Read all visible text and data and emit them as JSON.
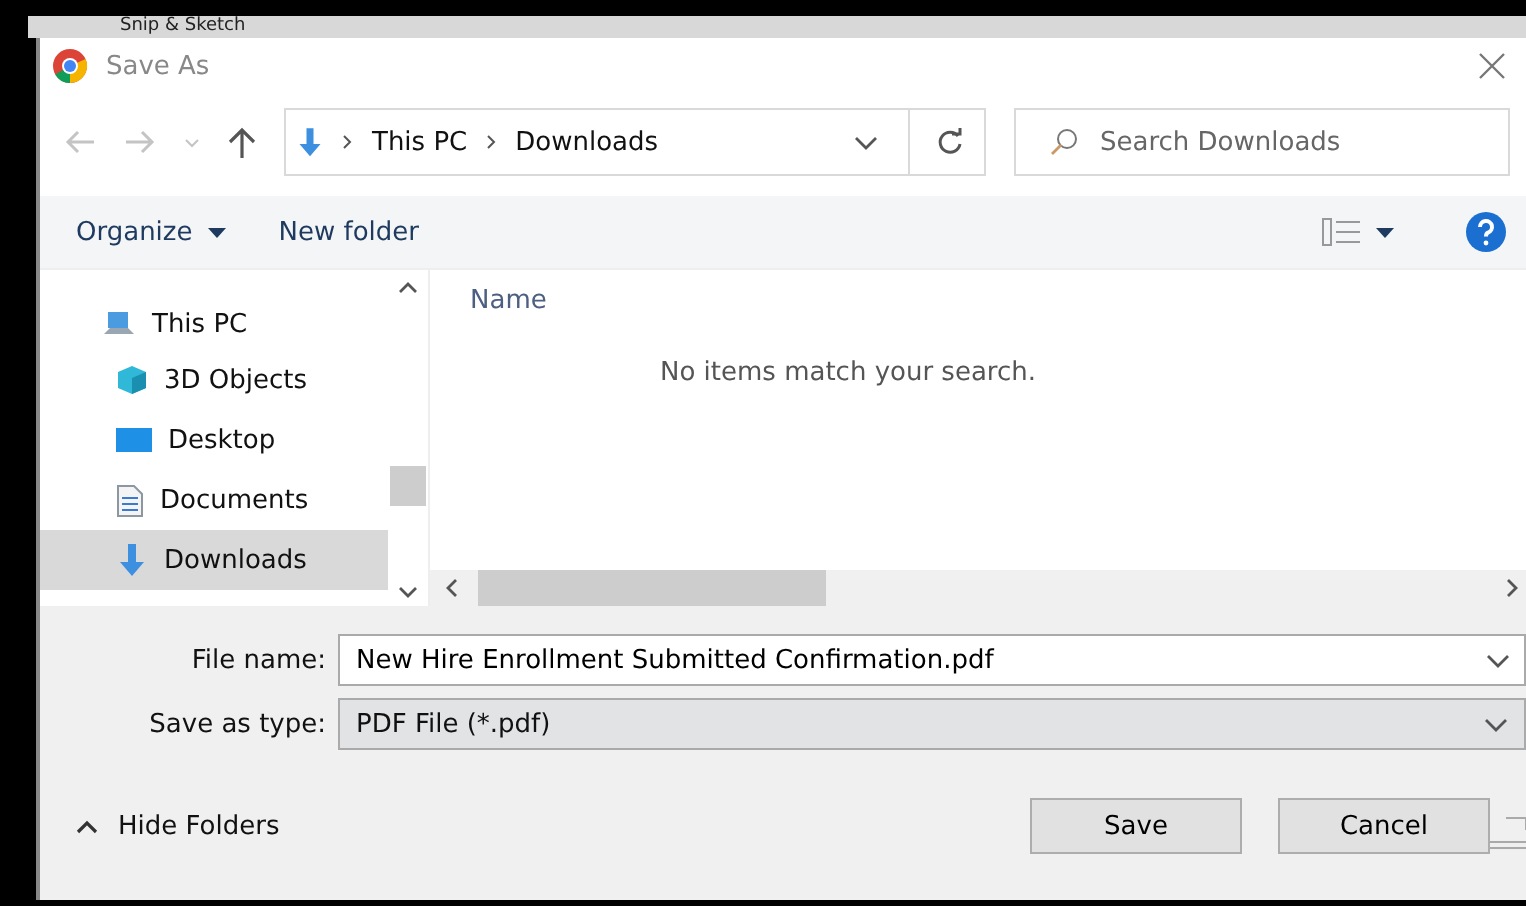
{
  "background_app": {
    "title": "Snip & Sketch"
  },
  "window": {
    "title": "Save As"
  },
  "nav": {
    "path": [
      "This PC",
      "Downloads"
    ],
    "search": {
      "placeholder": "Search Downloads"
    }
  },
  "toolbar": {
    "organize": "Organize",
    "new_folder": "New folder"
  },
  "sidebar": {
    "items": [
      {
        "label": "This PC",
        "kind": "pc",
        "selected": false,
        "children": [
          {
            "label": "3D Objects",
            "kind": "cube",
            "selected": false
          },
          {
            "label": "Desktop",
            "kind": "desktop",
            "selected": false
          },
          {
            "label": "Documents",
            "kind": "documents",
            "selected": false
          },
          {
            "label": "Downloads",
            "kind": "downloads",
            "selected": true
          }
        ]
      }
    ]
  },
  "file_list": {
    "columns": [
      "Name"
    ],
    "empty_message": "No items match your search."
  },
  "form": {
    "file_name": {
      "label": "File name:",
      "value": "New Hire Enrollment Submitted Confirmation.pdf"
    },
    "save_as_type": {
      "label": "Save as type:",
      "value": "PDF File (*.pdf)"
    }
  },
  "footer": {
    "hide_folders": "Hide Folders",
    "buttons": [
      "Save",
      "Cancel"
    ]
  }
}
